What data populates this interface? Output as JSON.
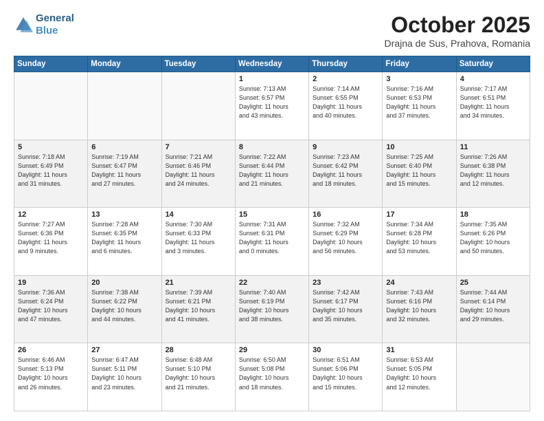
{
  "header": {
    "logo_line1": "General",
    "logo_line2": "Blue",
    "month": "October 2025",
    "location": "Drajna de Sus, Prahova, Romania"
  },
  "weekdays": [
    "Sunday",
    "Monday",
    "Tuesday",
    "Wednesday",
    "Thursday",
    "Friday",
    "Saturday"
  ],
  "weeks": [
    [
      {
        "day": "",
        "info": ""
      },
      {
        "day": "",
        "info": ""
      },
      {
        "day": "",
        "info": ""
      },
      {
        "day": "1",
        "info": "Sunrise: 7:13 AM\nSunset: 6:57 PM\nDaylight: 11 hours\nand 43 minutes."
      },
      {
        "day": "2",
        "info": "Sunrise: 7:14 AM\nSunset: 6:55 PM\nDaylight: 11 hours\nand 40 minutes."
      },
      {
        "day": "3",
        "info": "Sunrise: 7:16 AM\nSunset: 6:53 PM\nDaylight: 11 hours\nand 37 minutes."
      },
      {
        "day": "4",
        "info": "Sunrise: 7:17 AM\nSunset: 6:51 PM\nDaylight: 11 hours\nand 34 minutes."
      }
    ],
    [
      {
        "day": "5",
        "info": "Sunrise: 7:18 AM\nSunset: 6:49 PM\nDaylight: 11 hours\nand 31 minutes."
      },
      {
        "day": "6",
        "info": "Sunrise: 7:19 AM\nSunset: 6:47 PM\nDaylight: 11 hours\nand 27 minutes."
      },
      {
        "day": "7",
        "info": "Sunrise: 7:21 AM\nSunset: 6:46 PM\nDaylight: 11 hours\nand 24 minutes."
      },
      {
        "day": "8",
        "info": "Sunrise: 7:22 AM\nSunset: 6:44 PM\nDaylight: 11 hours\nand 21 minutes."
      },
      {
        "day": "9",
        "info": "Sunrise: 7:23 AM\nSunset: 6:42 PM\nDaylight: 11 hours\nand 18 minutes."
      },
      {
        "day": "10",
        "info": "Sunrise: 7:25 AM\nSunset: 6:40 PM\nDaylight: 11 hours\nand 15 minutes."
      },
      {
        "day": "11",
        "info": "Sunrise: 7:26 AM\nSunset: 6:38 PM\nDaylight: 11 hours\nand 12 minutes."
      }
    ],
    [
      {
        "day": "12",
        "info": "Sunrise: 7:27 AM\nSunset: 6:36 PM\nDaylight: 11 hours\nand 9 minutes."
      },
      {
        "day": "13",
        "info": "Sunrise: 7:28 AM\nSunset: 6:35 PM\nDaylight: 11 hours\nand 6 minutes."
      },
      {
        "day": "14",
        "info": "Sunrise: 7:30 AM\nSunset: 6:33 PM\nDaylight: 11 hours\nand 3 minutes."
      },
      {
        "day": "15",
        "info": "Sunrise: 7:31 AM\nSunset: 6:31 PM\nDaylight: 11 hours\nand 0 minutes."
      },
      {
        "day": "16",
        "info": "Sunrise: 7:32 AM\nSunset: 6:29 PM\nDaylight: 10 hours\nand 56 minutes."
      },
      {
        "day": "17",
        "info": "Sunrise: 7:34 AM\nSunset: 6:28 PM\nDaylight: 10 hours\nand 53 minutes."
      },
      {
        "day": "18",
        "info": "Sunrise: 7:35 AM\nSunset: 6:26 PM\nDaylight: 10 hours\nand 50 minutes."
      }
    ],
    [
      {
        "day": "19",
        "info": "Sunrise: 7:36 AM\nSunset: 6:24 PM\nDaylight: 10 hours\nand 47 minutes."
      },
      {
        "day": "20",
        "info": "Sunrise: 7:38 AM\nSunset: 6:22 PM\nDaylight: 10 hours\nand 44 minutes."
      },
      {
        "day": "21",
        "info": "Sunrise: 7:39 AM\nSunset: 6:21 PM\nDaylight: 10 hours\nand 41 minutes."
      },
      {
        "day": "22",
        "info": "Sunrise: 7:40 AM\nSunset: 6:19 PM\nDaylight: 10 hours\nand 38 minutes."
      },
      {
        "day": "23",
        "info": "Sunrise: 7:42 AM\nSunset: 6:17 PM\nDaylight: 10 hours\nand 35 minutes."
      },
      {
        "day": "24",
        "info": "Sunrise: 7:43 AM\nSunset: 6:16 PM\nDaylight: 10 hours\nand 32 minutes."
      },
      {
        "day": "25",
        "info": "Sunrise: 7:44 AM\nSunset: 6:14 PM\nDaylight: 10 hours\nand 29 minutes."
      }
    ],
    [
      {
        "day": "26",
        "info": "Sunrise: 6:46 AM\nSunset: 5:13 PM\nDaylight: 10 hours\nand 26 minutes."
      },
      {
        "day": "27",
        "info": "Sunrise: 6:47 AM\nSunset: 5:11 PM\nDaylight: 10 hours\nand 23 minutes."
      },
      {
        "day": "28",
        "info": "Sunrise: 6:48 AM\nSunset: 5:10 PM\nDaylight: 10 hours\nand 21 minutes."
      },
      {
        "day": "29",
        "info": "Sunrise: 6:50 AM\nSunset: 5:08 PM\nDaylight: 10 hours\nand 18 minutes."
      },
      {
        "day": "30",
        "info": "Sunrise: 6:51 AM\nSunset: 5:06 PM\nDaylight: 10 hours\nand 15 minutes."
      },
      {
        "day": "31",
        "info": "Sunrise: 6:53 AM\nSunset: 5:05 PM\nDaylight: 10 hours\nand 12 minutes."
      },
      {
        "day": "",
        "info": ""
      }
    ]
  ]
}
